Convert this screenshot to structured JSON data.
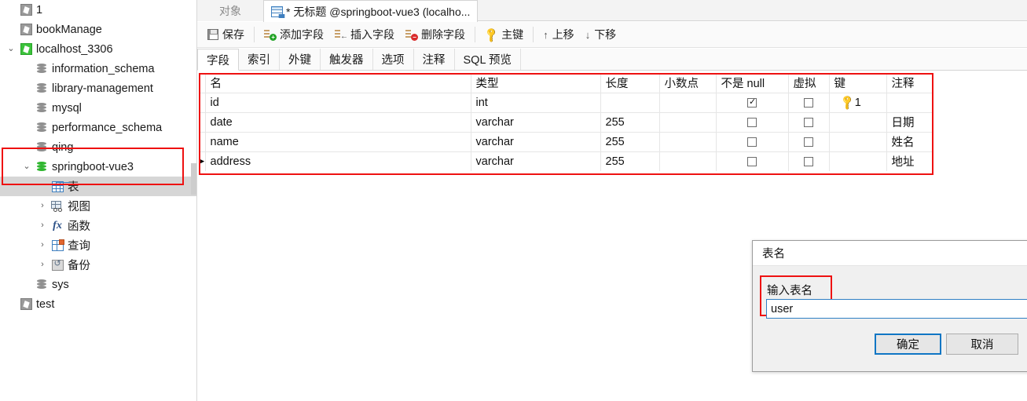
{
  "sidebar": {
    "items": [
      {
        "label": "1",
        "icon": "connection-icon",
        "indent": 0,
        "twisty": "",
        "selected": false,
        "iconKind": "conn"
      },
      {
        "label": "bookManage",
        "icon": "connection-icon",
        "indent": 0,
        "twisty": "",
        "selected": false,
        "iconKind": "conn"
      },
      {
        "label": "localhost_3306",
        "icon": "connection-active-icon",
        "indent": 0,
        "twisty": "v",
        "selected": false,
        "iconKind": "conn-on"
      },
      {
        "label": "information_schema",
        "icon": "database-icon",
        "indent": 1,
        "twisty": "",
        "selected": false,
        "iconKind": "db"
      },
      {
        "label": "library-management",
        "icon": "database-icon",
        "indent": 1,
        "twisty": "",
        "selected": false,
        "iconKind": "db"
      },
      {
        "label": "mysql",
        "icon": "database-icon",
        "indent": 1,
        "twisty": "",
        "selected": false,
        "iconKind": "db"
      },
      {
        "label": "performance_schema",
        "icon": "database-icon",
        "indent": 1,
        "twisty": "",
        "selected": false,
        "iconKind": "db"
      },
      {
        "label": "qing",
        "icon": "database-icon",
        "indent": 1,
        "twisty": "",
        "selected": false,
        "iconKind": "db"
      },
      {
        "label": "springboot-vue3",
        "icon": "database-open-icon",
        "indent": 1,
        "twisty": "v",
        "selected": false,
        "iconKind": "db-green"
      },
      {
        "label": "表",
        "icon": "table-icon",
        "indent": 2,
        "twisty": "",
        "selected": true,
        "iconKind": "table"
      },
      {
        "label": "视图",
        "icon": "view-icon",
        "indent": 2,
        "twisty": ">",
        "selected": false,
        "iconKind": "view"
      },
      {
        "label": "函数",
        "icon": "function-icon",
        "indent": 2,
        "twisty": ">",
        "selected": false,
        "iconKind": "fx"
      },
      {
        "label": "查询",
        "icon": "query-icon",
        "indent": 2,
        "twisty": ">",
        "selected": false,
        "iconKind": "query"
      },
      {
        "label": "备份",
        "icon": "backup-icon",
        "indent": 2,
        "twisty": ">",
        "selected": false,
        "iconKind": "backup"
      },
      {
        "label": "sys",
        "icon": "database-icon",
        "indent": 1,
        "twisty": "",
        "selected": false,
        "iconKind": "db"
      },
      {
        "label": "test",
        "icon": "connection-icon",
        "indent": 0,
        "twisty": "",
        "selected": false,
        "iconKind": "conn"
      }
    ],
    "highlight_item": "springboot-vue3"
  },
  "tabs": {
    "object_tab": "对象",
    "editor_tab": "* 无标题 @springboot-vue3 (localho..."
  },
  "toolbar": {
    "save": "保存",
    "add_field": "添加字段",
    "insert_field": "插入字段",
    "delete_field": "删除字段",
    "primary_key": "主键",
    "move_up": "上移",
    "move_down": "下移",
    "up_arrow": "↑",
    "down_arrow": "↓"
  },
  "subtabs": [
    {
      "label": "字段",
      "active": true
    },
    {
      "label": "索引",
      "active": false
    },
    {
      "label": "外键",
      "active": false
    },
    {
      "label": "触发器",
      "active": false
    },
    {
      "label": "选项",
      "active": false
    },
    {
      "label": "注释",
      "active": false
    },
    {
      "label": "SQL 预览",
      "active": false
    }
  ],
  "grid": {
    "columns": [
      "名",
      "类型",
      "长度",
      "小数点",
      "不是 null",
      "虚拟",
      "键",
      "注释"
    ],
    "rows": [
      {
        "marker": "",
        "name": "id",
        "type": "int",
        "length": "",
        "decimals": "",
        "notnull": true,
        "virtual": false,
        "key": "1",
        "comment": ""
      },
      {
        "marker": "",
        "name": "date",
        "type": "varchar",
        "length": "255",
        "decimals": "",
        "notnull": false,
        "virtual": false,
        "key": "",
        "comment": "日期"
      },
      {
        "marker": "",
        "name": "name",
        "type": "varchar",
        "length": "255",
        "decimals": "",
        "notnull": false,
        "virtual": false,
        "key": "",
        "comment": "姓名"
      },
      {
        "marker": "▶",
        "name": "address",
        "type": "varchar",
        "length": "255",
        "decimals": "",
        "notnull": false,
        "virtual": false,
        "key": "",
        "comment": "地址"
      }
    ]
  },
  "dialog": {
    "title": "表名",
    "close_glyph": "✕",
    "field_label": "输入表名",
    "input_value": "user",
    "ok_label": "确定",
    "cancel_label": "取消"
  },
  "colors": {
    "highlight_red": "#ee1111",
    "accent_blue": "#1076c4",
    "selection_gray": "#d6d6d6"
  }
}
